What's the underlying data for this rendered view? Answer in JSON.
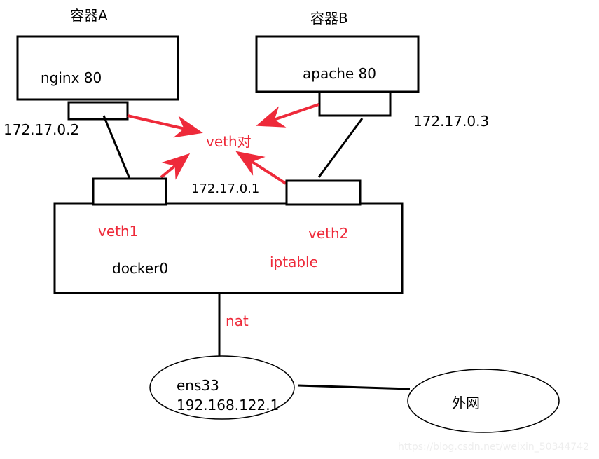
{
  "container_a": {
    "title": "容器A",
    "service": "nginx 80",
    "ip": "172.17.0.2"
  },
  "container_b": {
    "title": "容器B",
    "service": "apache 80",
    "ip": "172.17.0.3"
  },
  "veth_pair_label": "veth对",
  "bridge": {
    "name": "docker0",
    "ip": "172.17.0.1",
    "veth1": "veth1",
    "veth2": "veth2",
    "iptable": "iptable"
  },
  "nat_label": "nat",
  "host_nic": {
    "name": "ens33",
    "ip": "192.168.122.1"
  },
  "external": "外网",
  "watermark": "https://blog.csdn.net/weixin_50344742",
  "colors": {
    "annotation": "#ee2a3a",
    "line": "#000000"
  }
}
